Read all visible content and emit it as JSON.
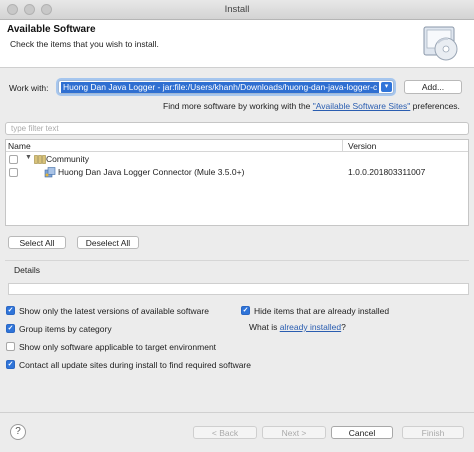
{
  "window": {
    "title": "Install"
  },
  "header": {
    "title": "Available Software",
    "subtitle": "Check the items that you wish to install."
  },
  "work_with": {
    "label": "Work with:",
    "value": "Huong Dan Java Logger - jar:file:/Users/khanh/Downloads/huong-dan-java-logger-c",
    "add_label": "Add...",
    "more_prefix": "Find more software by working with the ",
    "more_link": "\"Available Software Sites\"",
    "more_suffix": " preferences."
  },
  "filter": {
    "placeholder": "type filter text"
  },
  "table": {
    "columns": [
      "Name",
      "Version"
    ],
    "rows": [
      {
        "name": "Community",
        "version": ""
      },
      {
        "name": "Huong Dan Java Logger Connector (Mule 3.5.0+)",
        "version": "1.0.0.201803311007"
      }
    ]
  },
  "selection": {
    "select_all": "Select All",
    "deselect_all": "Deselect All"
  },
  "details": {
    "label": "Details"
  },
  "options": {
    "latest_versions": {
      "label": "Show only the latest versions of available software",
      "checked": true
    },
    "hide_installed": {
      "label": "Hide items that are already installed",
      "checked": true
    },
    "group_category": {
      "label": "Group items by category",
      "checked": true
    },
    "what_installed_prefix": "What is ",
    "what_installed_link": "already installed",
    "what_installed_suffix": "?",
    "target_env": {
      "label": "Show only software applicable to target environment",
      "checked": false
    },
    "contact_sites": {
      "label": "Contact all update sites during install to find required software",
      "checked": true
    }
  },
  "footer": {
    "help": "?",
    "back": "< Back",
    "next": "Next >",
    "cancel": "Cancel",
    "finish": "Finish"
  },
  "icons": {
    "header": "install-cd-icon",
    "category": "category-folder-icon",
    "feature": "plugin-feature-icon",
    "help": "help-icon"
  },
  "colors": {
    "accent": "#2f74d9",
    "link": "#2a5db0",
    "selection": "#2f6fd1"
  }
}
